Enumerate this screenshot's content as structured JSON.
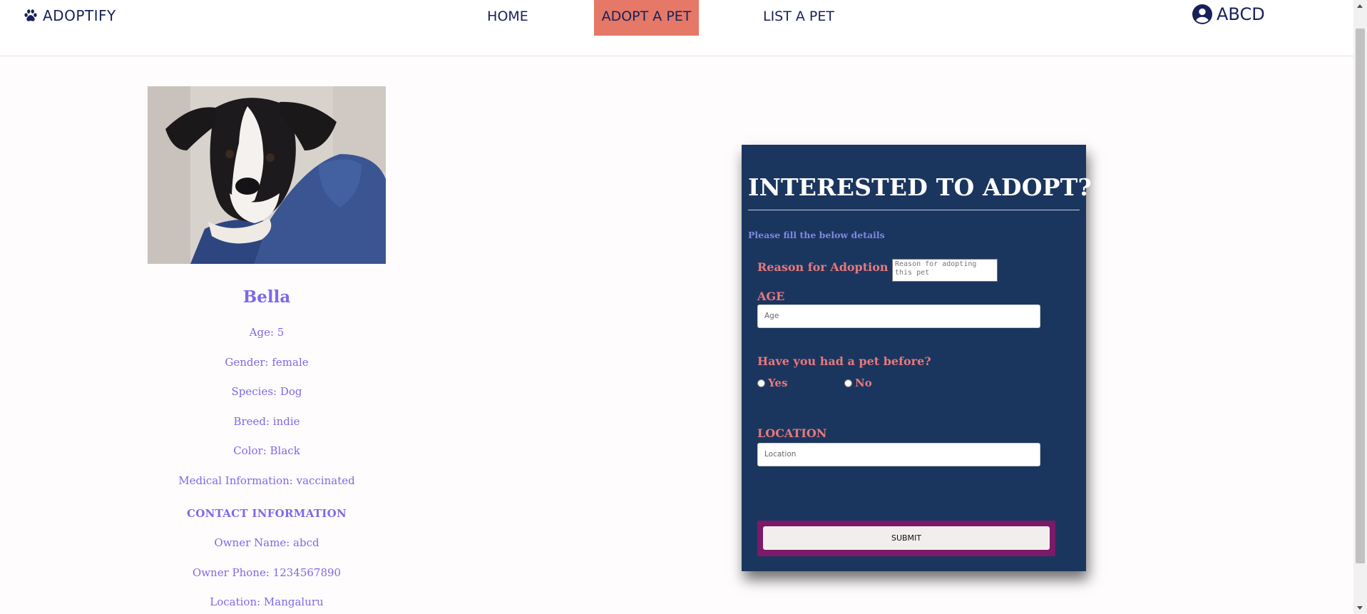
{
  "navbar": {
    "brand": "ADOPTIFY",
    "links": [
      "HOME",
      "ADOPT A PET",
      "LIST A PET"
    ],
    "active_link": "ADOPT A PET",
    "user": "ABCD",
    "active_color": "#e57867",
    "text_color": "#16215a"
  },
  "pet": {
    "name": "Bella",
    "age": "Age: 5",
    "gender": "Gender: female",
    "species": "Species: Dog",
    "breed": "Breed: indie",
    "color": "Color: Black",
    "medical": "Medical Information: vaccinated",
    "contact_title": "CONTACT INFORMATION",
    "owner_name": "Owner Name: abcd",
    "owner_phone": "Owner Phone: 1234567890",
    "location": "Location: Mangaluru",
    "photo_icon": "dog-photo"
  },
  "form": {
    "title": "INTERESTED TO ADOPT?",
    "subtitle": "Please fill the below details",
    "reason_label": "Reason for Adoption",
    "reason_placeholder": "Reason for adopting this pet",
    "age_label": "AGE",
    "age_placeholder": "Age",
    "pet_before_label": "Have you had a pet before?",
    "options": [
      "Yes",
      "No"
    ],
    "location_label": "LOCATION",
    "location_placeholder": "Location",
    "submit_label": "SUBMIT",
    "card_color": "#1b365e",
    "label_color": "#e8787d"
  }
}
